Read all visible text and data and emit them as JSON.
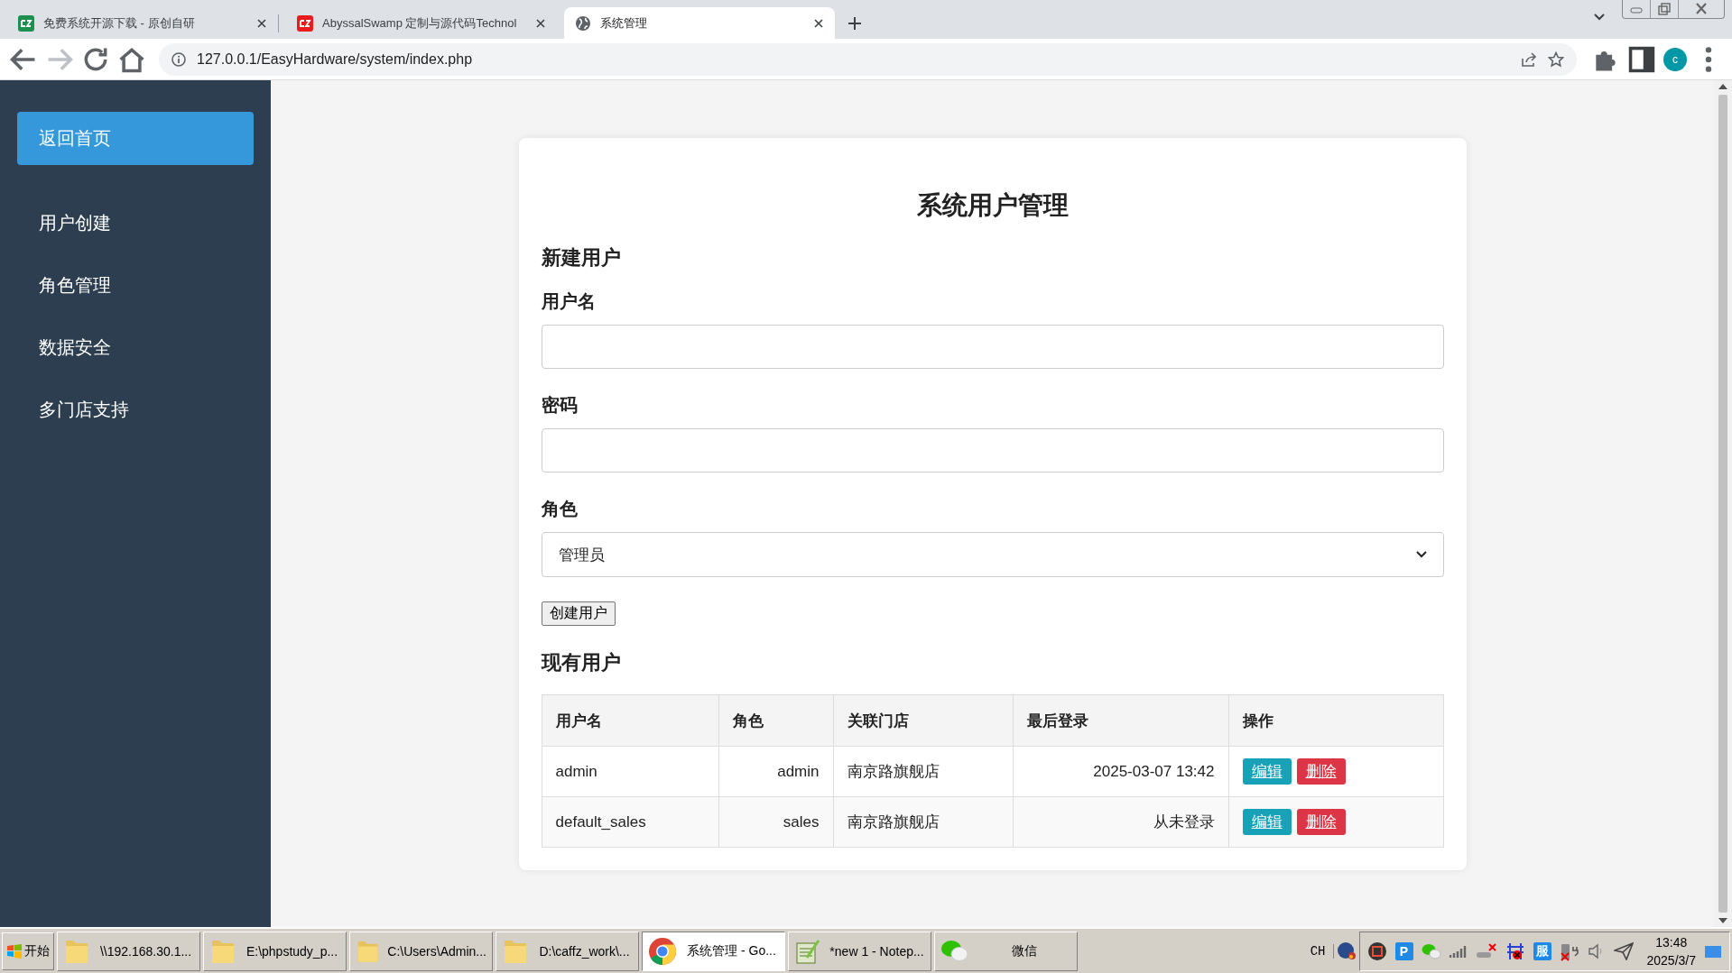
{
  "browser": {
    "tabs": [
      {
        "title": "免费系统开源下载 - 原创自研",
        "kind": "logo",
        "color": "#1e8f4e",
        "selected": false
      },
      {
        "title": "AbyssalSwamp 定制与源代码Technol",
        "kind": "logo",
        "color": "#e81c1c",
        "selected": false
      },
      {
        "title": "系统管理",
        "kind": "globe",
        "selected": true
      }
    ],
    "url": "127.0.0.1/EasyHardware/system/index.php",
    "avatar": "c"
  },
  "sidebar": {
    "items": [
      {
        "label": "返回首页",
        "selected": true
      },
      {
        "label": "用户创建",
        "selected": false
      },
      {
        "label": "角色管理",
        "selected": false
      },
      {
        "label": "数据安全",
        "selected": false
      },
      {
        "label": "多门店支持",
        "selected": false
      }
    ]
  },
  "page": {
    "title": "系统用户管理",
    "new_user_heading": "新建用户",
    "fields": [
      {
        "kind": "text",
        "label": "用户名"
      },
      {
        "kind": "password",
        "label": "密码"
      },
      {
        "kind": "select",
        "label": "角色",
        "value": "管理员"
      }
    ],
    "create_button": "创建用户",
    "existing_heading": "现有用户",
    "table": {
      "columns": [
        "用户名",
        "角色",
        "关联门店",
        "最后登录",
        "操作"
      ],
      "rows": [
        {
          "cells": [
            "admin",
            "admin",
            "南京路旗舰店",
            "2025-03-07 13:42"
          ],
          "actions": [
            {
              "kind": "edit",
              "label": "编辑"
            },
            {
              "kind": "delete",
              "label": "删除"
            }
          ]
        },
        {
          "cells": [
            "default_sales",
            "sales",
            "南京路旗舰店",
            "从未登录"
          ],
          "actions": [
            {
              "kind": "edit",
              "label": "编辑"
            },
            {
              "kind": "delete",
              "label": "删除"
            }
          ]
        }
      ]
    }
  },
  "taskbar": {
    "start": "开始",
    "items": [
      {
        "label": "\\\\192.168.30.1...",
        "kind": "folder",
        "selected": false
      },
      {
        "label": "E:\\phpstudy_p...",
        "kind": "folder",
        "selected": false
      },
      {
        "label": "C:\\Users\\Admin...",
        "kind": "folder",
        "selected": false
      },
      {
        "label": "D:\\caffz_work\\...",
        "kind": "folder",
        "selected": false
      },
      {
        "label": "系统管理 - Go...",
        "kind": "browser",
        "selected": true
      },
      {
        "label": "*new 1 - Notep...",
        "kind": "editor",
        "selected": false
      },
      {
        "label": "微信",
        "kind": "chat",
        "selected": false
      }
    ],
    "tray": {
      "language": "CH",
      "icons": [
        {
          "kind": "record"
        },
        {
          "kind": "badge",
          "text": "P"
        },
        {
          "kind": "wechat"
        },
        {
          "kind": "signal"
        },
        {
          "kind": "network-off"
        },
        {
          "kind": "network-error"
        },
        {
          "kind": "badge",
          "text": "服"
        },
        {
          "kind": "battery-off"
        },
        {
          "kind": "volume"
        },
        {
          "kind": "send"
        }
      ],
      "time": "13:48",
      "date": "2025/3/7"
    }
  }
}
